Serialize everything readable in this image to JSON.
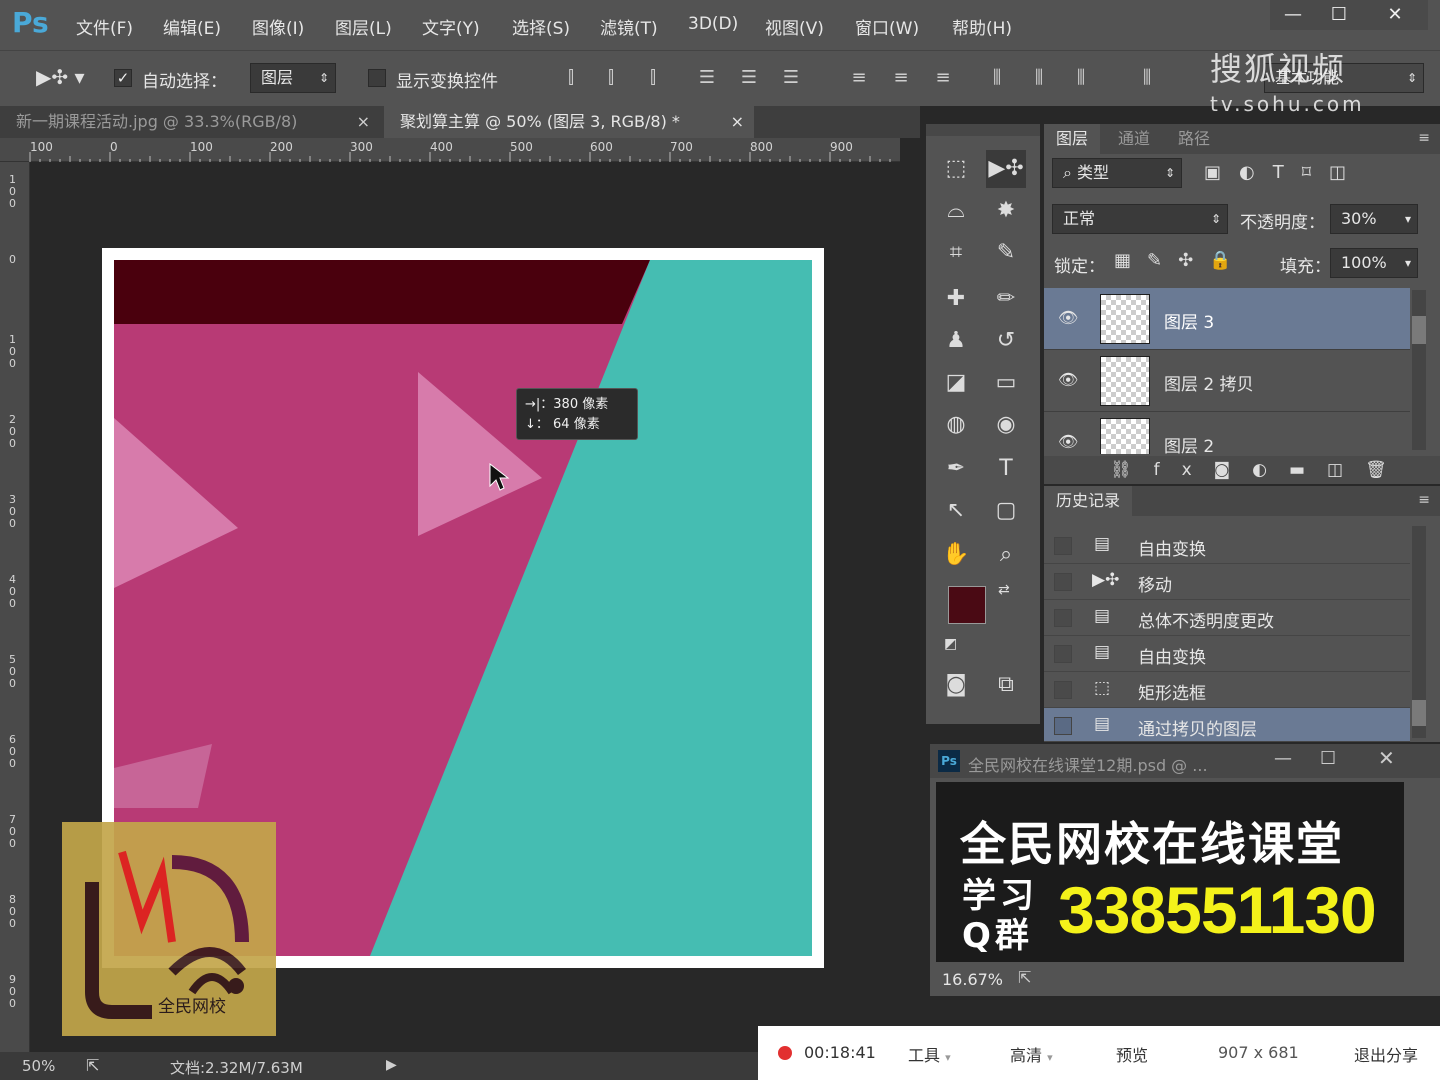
{
  "app": {
    "logo": "Ps",
    "menu": [
      "文件(F)",
      "编辑(E)",
      "图像(I)",
      "图层(L)",
      "文字(Y)",
      "选择(S)",
      "滤镜(T)",
      "3D(D)",
      "视图(V)",
      "窗口(W)",
      "帮助(H)"
    ],
    "window_buttons": [
      "—",
      "☐",
      "✕"
    ]
  },
  "options": {
    "auto_select_label": "自动选择：",
    "auto_select_value": "图层",
    "show_transform_label": "显示变换控件",
    "workspace_value": "基本功能"
  },
  "tabs": [
    {
      "label": "新一期课程活动.jpg @ 33.3%(RGB/8)",
      "close": "×"
    },
    {
      "label": "聚划算主算 @ 50% (图层 3, RGB/8) *",
      "close": "×"
    }
  ],
  "ruler": {
    "h_ticks": [
      "100",
      "0",
      "100",
      "200",
      "300",
      "400",
      "500",
      "600",
      "700",
      "800",
      "900"
    ],
    "v_ticks": [
      "100",
      "0",
      "100",
      "200",
      "300",
      "400",
      "500",
      "600",
      "700",
      "800",
      "900"
    ]
  },
  "tooltip": {
    "line1": "→|：380 像素",
    "line2": "↓：  64 像素"
  },
  "status": {
    "zoom": "50%",
    "doc": "文档:2.32M/7.63M"
  },
  "watermark": {
    "site_cn": "搜狐视频",
    "site_url": "tv.sohu.com"
  },
  "logo_overlay": {
    "text": "全民网校"
  },
  "layers_panel": {
    "tabs": [
      "图层",
      "通道",
      "路径"
    ],
    "filter_value": "类型",
    "blend_value": "正常",
    "opacity_label": "不透明度：",
    "opacity_value": "30%",
    "lock_label": "锁定：",
    "fill_label": "填充：",
    "fill_value": "100%",
    "layers": [
      {
        "name": "图层 3",
        "selected": true
      },
      {
        "name": "图层 2 拷贝",
        "selected": false
      },
      {
        "name": "图层 2",
        "selected": false
      }
    ]
  },
  "history_panel": {
    "title": "历史记录",
    "items": [
      {
        "label": "自由变换",
        "icon": "document-icon"
      },
      {
        "label": "移动",
        "icon": "move-icon"
      },
      {
        "label": "总体不透明度更改",
        "icon": "document-icon"
      },
      {
        "label": "自由变换",
        "icon": "document-icon"
      },
      {
        "label": "矩形选框",
        "icon": "marquee-icon"
      },
      {
        "label": "通过拷贝的图层",
        "icon": "document-icon",
        "selected": true
      }
    ]
  },
  "navigator": {
    "title": "全民网校在线课堂12期.psd @ ...",
    "banner_line1": "全民网校在线课堂",
    "banner_label": "学习Q群",
    "banner_number": "338551130",
    "zoom": "16.67%"
  },
  "recbar": {
    "time": "00:18:41",
    "tools": "工具",
    "quality": "高清",
    "preview": "预览",
    "size": "907 x 681",
    "exit": "退出分享"
  },
  "colors": {
    "dark_maroon": "#4a000d",
    "magenta": "#b83a75",
    "teal": "#45bdb2",
    "light_pink": "#d77bab",
    "foreground_swatch": "#4a0a14"
  }
}
